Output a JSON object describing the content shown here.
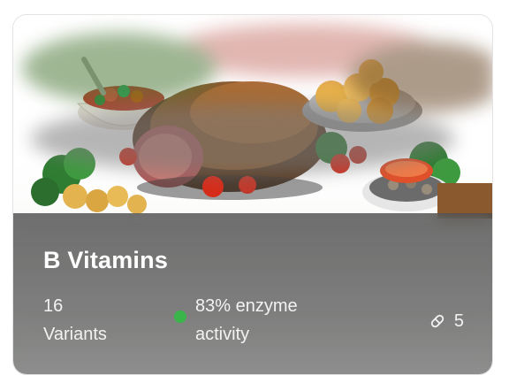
{
  "card": {
    "image_alt": "Roast meat platter with vegetables",
    "title": "B Vitamins",
    "variants": {
      "count": "16",
      "label": "Variants"
    },
    "activity": {
      "value": "83% enzyme",
      "suffix": "activity",
      "status_color": "#39b54a"
    },
    "pill_count": "5",
    "pill_icon": "pill-icon"
  }
}
